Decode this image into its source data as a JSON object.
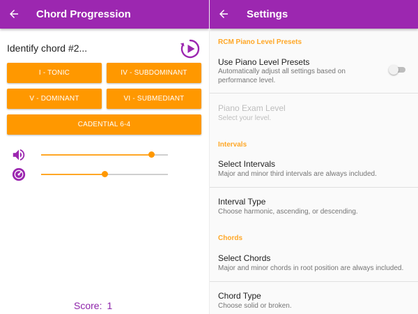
{
  "left": {
    "appbar": {
      "title": "Chord Progression",
      "back_icon": "arrow-left-icon"
    },
    "question": "Identify chord #2...",
    "play_icon": "replay-play-icon",
    "buttons": {
      "tonic": "I - TONIC",
      "subdominant": "IV - SUBDOMINANT",
      "dominant": "V - DOMINANT",
      "submediant": "VI - SUBMEDIANT",
      "cadential": "CADENTIAL 6-4"
    },
    "sliders": {
      "volume": {
        "icon": "volume-icon",
        "level": 0.87
      },
      "tempo": {
        "icon": "tempo-icon",
        "level": 0.5
      }
    },
    "score": {
      "label": "Score:",
      "value": "1"
    }
  },
  "right": {
    "appbar": {
      "title": "Settings",
      "back_icon": "arrow-left-icon"
    },
    "sections": {
      "rcm": {
        "header": "RCM Piano Level Presets",
        "use_presets": {
          "title": "Use Piano Level Presets",
          "summary": "Automatically adjust all settings based on performance level.",
          "enabled": false
        },
        "exam_level": {
          "title": "Piano Exam Level",
          "summary": "Select your level."
        }
      },
      "intervals": {
        "header": "Intervals",
        "select": {
          "title": "Select Intervals",
          "summary": "Major and minor third intervals are always included."
        },
        "type": {
          "title": "Interval Type",
          "summary": "Choose harmonic, ascending, or descending."
        }
      },
      "chords": {
        "header": "Chords",
        "select": {
          "title": "Select Chords",
          "summary": "Major and minor chords in root position are always included."
        },
        "type": {
          "title": "Chord Type",
          "summary": "Choose solid or broken."
        }
      }
    }
  },
  "colors": {
    "primary": "#9c27b0",
    "accent": "#ff9800",
    "category": "#ffa726",
    "score": "#8e24aa",
    "disabled": "#bdbdbd"
  }
}
